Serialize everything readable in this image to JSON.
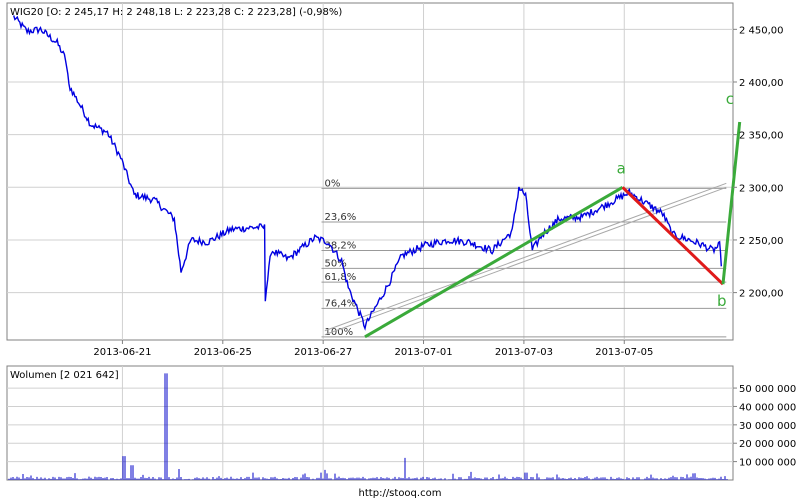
{
  "colors": {
    "price": "#0000e0",
    "volume": "#0000c8",
    "grid": "#d0d0d0",
    "frame": "#808080",
    "wave_up": "#3aaa3a",
    "wave_down": "#e01a1a",
    "fib": "#999999",
    "trend": "#a8a8a8"
  },
  "header": "WIG20 [O: 2 245,17  H: 2 248,18  L: 2 223,28  C: 2 223,28]  (-0,98%)",
  "volume_header": "Wolumen [2 021 642]",
  "footer": "http://stooq.com",
  "chart_data": [
    {
      "type": "line",
      "title": "WIG20 [O: 2 245,17  H: 2 248,18  L: 2 223,28  C: 2 223,28]  (-0,98%)",
      "ylim": [
        2155,
        2475
      ],
      "y_ticks": [
        2200,
        2250,
        2300,
        2350,
        2400,
        2450
      ],
      "y_tick_labels": [
        "2 200,00",
        "2 250,00",
        "2 300,00",
        "2 350,00",
        "2 400,00",
        "2 450,00"
      ],
      "x_ticks": [
        {
          "t": 3.25,
          "label": "2013-06-21"
        },
        {
          "t": 6.25,
          "label": "2013-06-25"
        },
        {
          "t": 9.25,
          "label": "2013-06-27"
        },
        {
          "t": 12.25,
          "label": "2013-07-01"
        },
        {
          "t": 15.25,
          "label": "2013-07-03"
        },
        {
          "t": 18.25,
          "label": "2013-07-05"
        }
      ],
      "x_range": [
        -0.2,
        21.5
      ],
      "anchors": [
        [
          0,
          2462
        ],
        [
          0.4,
          2448
        ],
        [
          0.8,
          2450
        ],
        [
          1.3,
          2437
        ],
        [
          1.55,
          2422
        ],
        [
          1.65,
          2397
        ],
        [
          2.3,
          2360
        ],
        [
          2.8,
          2352
        ],
        [
          3.2,
          2328
        ],
        [
          3.6,
          2293
        ],
        [
          4.2,
          2288
        ],
        [
          4.8,
          2270
        ],
        [
          5.0,
          2220
        ],
        [
          5.3,
          2250
        ],
        [
          5.8,
          2248
        ],
        [
          6.5,
          2260
        ],
        [
          7.2,
          2262
        ],
        [
          7.5,
          2262
        ],
        [
          7.52,
          2195
        ],
        [
          7.7,
          2240
        ],
        [
          8.2,
          2232
        ],
        [
          9.0,
          2252
        ],
        [
          9.4,
          2248
        ],
        [
          9.8,
          2230
        ],
        [
          10.0,
          2205
        ],
        [
          10.5,
          2168
        ],
        [
          10.8,
          2185
        ],
        [
          11.2,
          2208
        ],
        [
          11.6,
          2235
        ],
        [
          12.3,
          2245
        ],
        [
          13.0,
          2250
        ],
        [
          13.6,
          2248
        ],
        [
          14.3,
          2240
        ],
        [
          14.9,
          2258
        ],
        [
          15.1,
          2300
        ],
        [
          15.3,
          2292
        ],
        [
          15.5,
          2240
        ],
        [
          15.8,
          2255
        ],
        [
          16.3,
          2270
        ],
        [
          17.0,
          2272
        ],
        [
          17.8,
          2285
        ],
        [
          18.4,
          2295
        ],
        [
          18.9,
          2285
        ],
        [
          19.4,
          2275
        ],
        [
          19.7,
          2255
        ],
        [
          20.2,
          2250
        ],
        [
          20.6,
          2245
        ],
        [
          20.9,
          2240
        ],
        [
          21.1,
          2245
        ],
        [
          21.15,
          2225
        ]
      ],
      "fib_levels": [
        {
          "label": "0%",
          "value": 2299
        },
        {
          "label": "23,6%",
          "value": 2267
        },
        {
          "label": "38,2%",
          "value": 2240
        },
        {
          "label": "50%",
          "value": 2223
        },
        {
          "label": "61,8%",
          "value": 2210
        },
        {
          "label": "76,4%",
          "value": 2185
        },
        {
          "label": "100%",
          "value": 2158
        }
      ],
      "fib_range_t": [
        9.2,
        21.3
      ],
      "trend_line": [
        [
          9.3,
          2160
        ],
        [
          21.3,
          2300
        ]
      ],
      "waves": [
        {
          "label": "a",
          "color": "up",
          "from": [
            10.5,
            2158
          ],
          "to": [
            18.2,
            2300
          ]
        },
        {
          "label": "b",
          "color": "down",
          "from": [
            18.2,
            2300
          ],
          "to": [
            21.2,
            2208
          ]
        },
        {
          "label": "c",
          "color": "up",
          "from": [
            21.2,
            2208
          ],
          "to": [
            21.7,
            2362
          ]
        }
      ]
    },
    {
      "type": "bar",
      "title": "Wolumen [2 021 642]",
      "ylim": [
        0,
        62000000
      ],
      "y_ticks": [
        10000000,
        20000000,
        30000000,
        40000000,
        50000000
      ],
      "y_tick_labels": [
        "10 000 000",
        "20 000 000",
        "30 000 000",
        "40 000 000",
        "50 000 000"
      ],
      "spikes": [
        {
          "t": 3.3,
          "v": 13000000
        },
        {
          "t": 3.55,
          "v": 8000000
        },
        {
          "t": 4.55,
          "v": 58000000
        },
        {
          "t": 4.95,
          "v": 6000000
        },
        {
          "t": 9.3,
          "v": 5500000
        },
        {
          "t": 11.7,
          "v": 12000000
        },
        {
          "t": 15.3,
          "v": 4000000
        }
      ]
    }
  ]
}
